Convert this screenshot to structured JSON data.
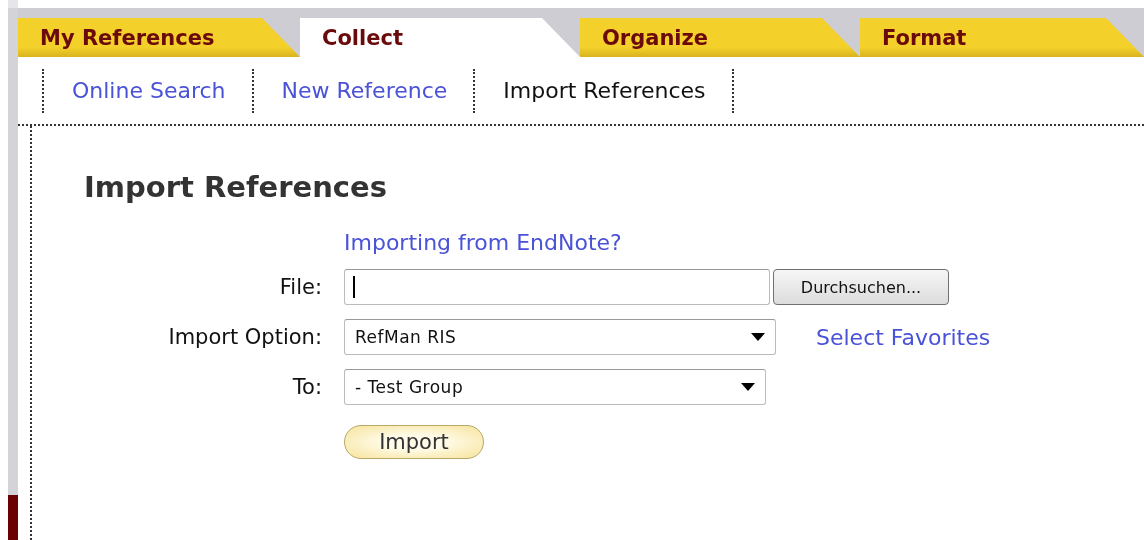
{
  "tabs": [
    {
      "label": "My References",
      "selected": false
    },
    {
      "label": "Collect",
      "selected": true
    },
    {
      "label": "Organize",
      "selected": false
    },
    {
      "label": "Format",
      "selected": false
    }
  ],
  "subnav": [
    {
      "label": "Online Search",
      "selected": false
    },
    {
      "label": "New Reference",
      "selected": false
    },
    {
      "label": "Import References",
      "selected": true
    }
  ],
  "heading": "Import References",
  "endnote_link": "Importing from EndNote?",
  "file": {
    "label": "File:",
    "focused": true,
    "browse_button": "Durchsuchen..."
  },
  "import_option": {
    "label": "Import Option:",
    "value": "RefMan RIS",
    "link": "Select Favorites"
  },
  "to": {
    "label": "To:",
    "value": "- Test Group"
  },
  "import_button": "Import"
}
